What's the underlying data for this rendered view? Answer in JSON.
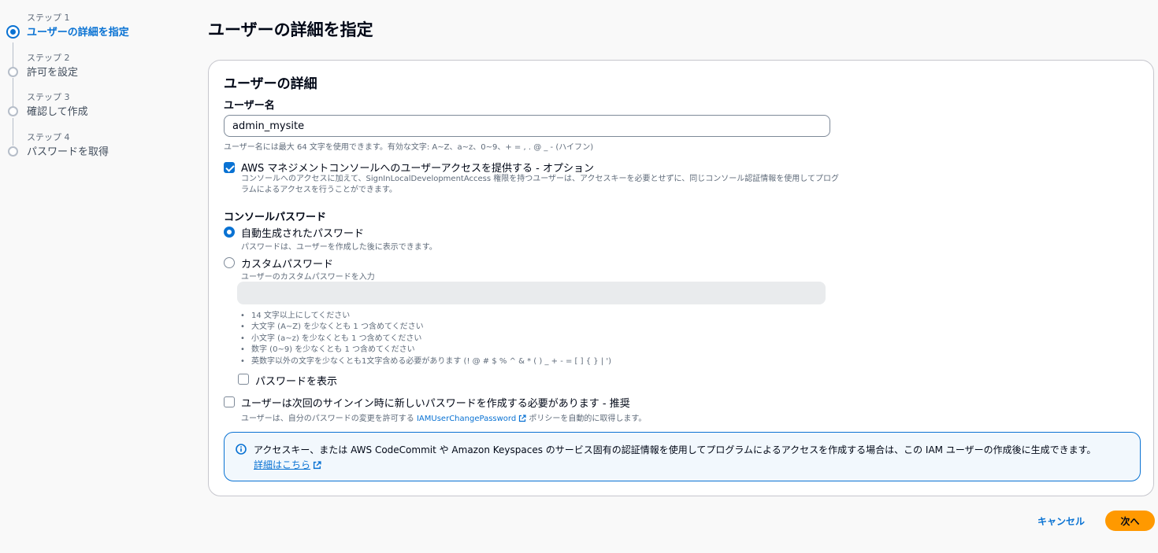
{
  "wizard": {
    "steps": [
      {
        "number": "ステップ 1",
        "label": "ユーザーの詳細を指定",
        "active": true
      },
      {
        "number": "ステップ 2",
        "label": "許可を設定",
        "active": false
      },
      {
        "number": "ステップ 3",
        "label": "確認して作成",
        "active": false
      },
      {
        "number": "ステップ 4",
        "label": "パスワードを取得",
        "active": false
      }
    ]
  },
  "page": {
    "title": "ユーザーの詳細を指定"
  },
  "panel": {
    "title": "ユーザーの詳細",
    "username": {
      "label": "ユーザー名",
      "value": "admin_mysite",
      "hint": "ユーザー名には最大 64 文字を使用できます。有効な文字: A~Z、a~z、0~9、+ = , . @ _ - (ハイフン)"
    },
    "console_access": {
      "checked": true,
      "label": "AWS マネジメントコンソールへのユーザーアクセスを提供する - オプション",
      "description": "コンソールへのアクセスに加えて、SignInLocalDevelopmentAccess 権限を持つユーザーは、アクセスキーを必要とせずに、同じコンソール認証情報を使用してプログラムによるアクセスを行うことができます。"
    },
    "console_password": {
      "label": "コンソールパスワード",
      "autogen": {
        "checked": true,
        "label": "自動生成されたパスワード",
        "description": "パスワードは、ユーザーを作成した後に表示できます。"
      },
      "custom": {
        "checked": false,
        "label": "カスタムパスワード",
        "description": "ユーザーのカスタムパスワードを入力",
        "value": ""
      },
      "rules": [
        "14 文字以上にしてください",
        "大文字 (A~Z) を少なくとも 1 つ含めてください",
        "小文字 (a~z) を少なくとも 1 つ含めてください",
        "数字 (0~9) を少なくとも 1 つ含めてください",
        "英数字以外の文字を少なくとも1文字含める必要があります (! @ # $ % ^ & * ( ) _ + - = [ ] { } | ')"
      ],
      "show_password": {
        "checked": false,
        "label": "パスワードを表示"
      }
    },
    "reset_required": {
      "checked": false,
      "label": "ユーザーは次回のサインイン時に新しいパスワードを作成する必要があります - 推奨",
      "desc_prefix": "ユーザーは、自分のパスワードの変更を許可する ",
      "desc_link": "IAMUserChangePassword",
      "desc_suffix": " ポリシーを自動的に取得します。"
    },
    "info": {
      "text": "アクセスキー、または AWS CodeCommit や Amazon Keyspaces のサービス固有の認証情報を使用してプログラムによるアクセスを作成する場合は、この IAM ユーザーの作成後に生成できます。",
      "link": "詳細はこちら"
    }
  },
  "footer": {
    "cancel_label": "キャンセル",
    "next_label": "次へ"
  },
  "colors": {
    "accent": "#0972d3",
    "primary_button": "#ff9900",
    "info_bg": "#f2f8fd"
  }
}
